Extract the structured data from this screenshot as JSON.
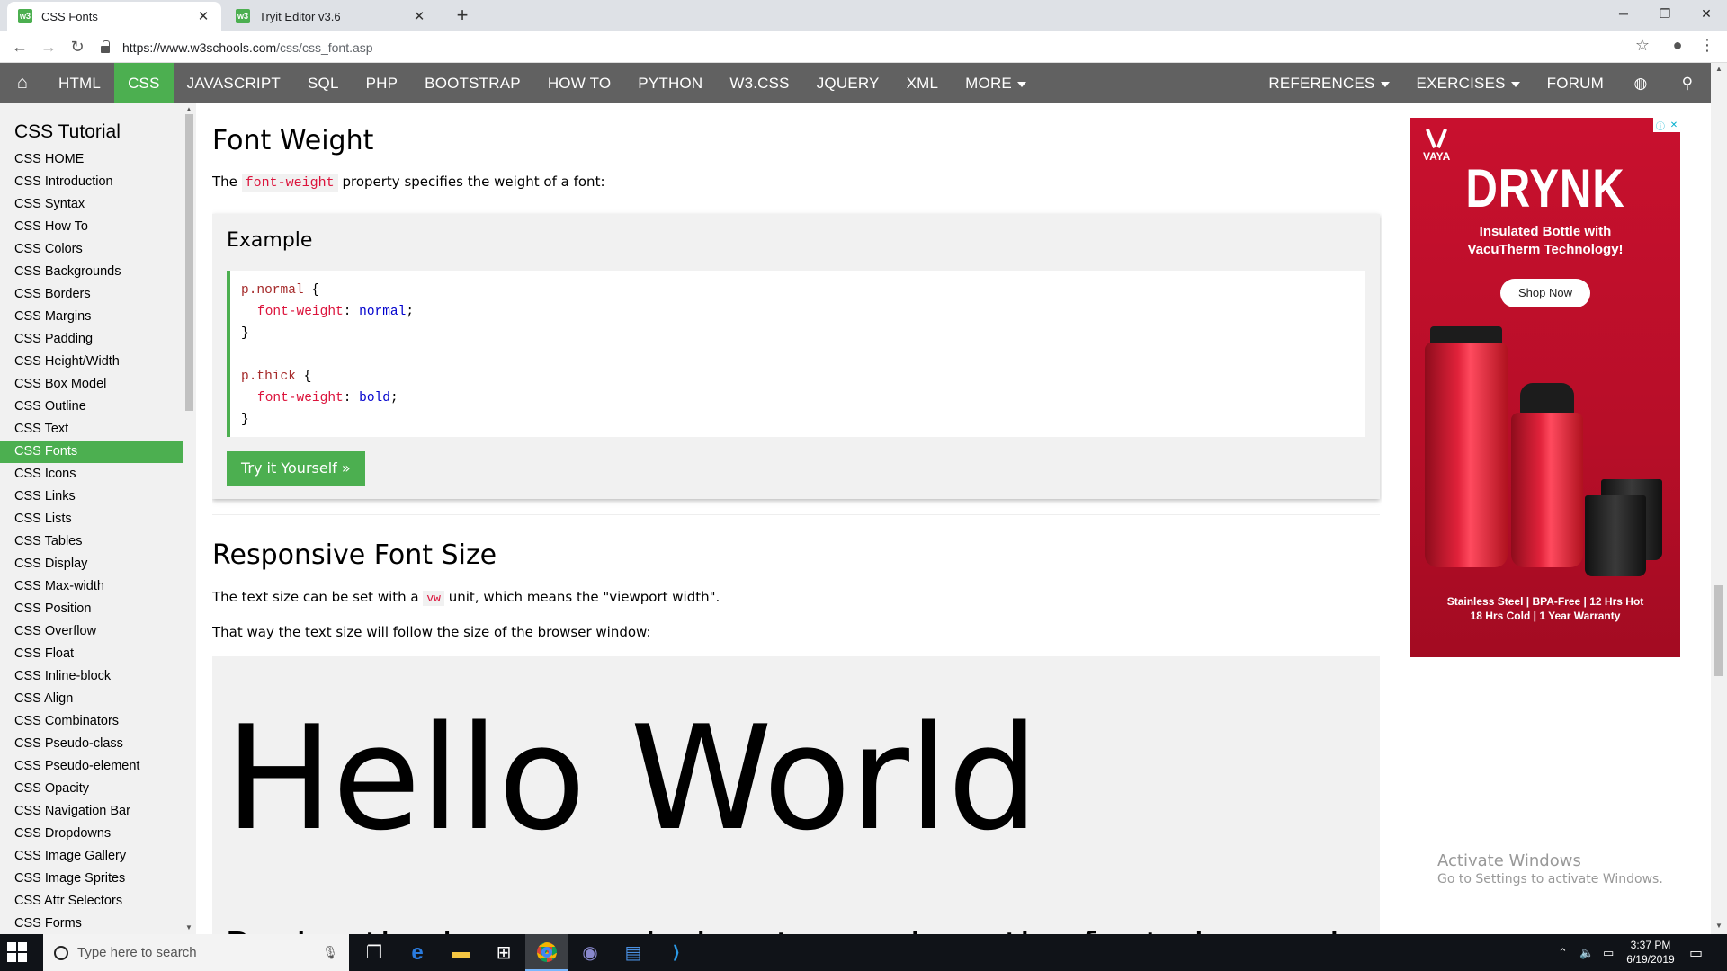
{
  "browser": {
    "tabs": [
      {
        "title": "CSS Fonts",
        "favicon": "w3"
      },
      {
        "title": "Tryit Editor v3.6",
        "favicon": "w3"
      }
    ],
    "new_tab_symbol": "+",
    "window_controls": {
      "minimize": "─",
      "maximize": "❐",
      "close": "✕"
    },
    "url_host": "https://www.w3schools.com",
    "url_path": "/css/css_font.asp"
  },
  "w3nav": {
    "left": [
      "HTML",
      "CSS",
      "JAVASCRIPT",
      "SQL",
      "PHP",
      "BOOTSTRAP",
      "HOW TO",
      "PYTHON",
      "W3.CSS",
      "JQUERY",
      "XML",
      "MORE"
    ],
    "active": "CSS",
    "right": [
      "REFERENCES",
      "EXERCISES",
      "FORUM"
    ]
  },
  "sidebar": {
    "title": "CSS Tutorial",
    "items": [
      "CSS HOME",
      "CSS Introduction",
      "CSS Syntax",
      "CSS How To",
      "CSS Colors",
      "CSS Backgrounds",
      "CSS Borders",
      "CSS Margins",
      "CSS Padding",
      "CSS Height/Width",
      "CSS Box Model",
      "CSS Outline",
      "CSS Text",
      "CSS Fonts",
      "CSS Icons",
      "CSS Links",
      "CSS Lists",
      "CSS Tables",
      "CSS Display",
      "CSS Max-width",
      "CSS Position",
      "CSS Overflow",
      "CSS Float",
      "CSS Inline-block",
      "CSS Align",
      "CSS Combinators",
      "CSS Pseudo-class",
      "CSS Pseudo-element",
      "CSS Opacity",
      "CSS Navigation Bar",
      "CSS Dropdowns",
      "CSS Image Gallery",
      "CSS Image Sprites",
      "CSS Attr Selectors",
      "CSS Forms"
    ],
    "active_item": "CSS Fonts"
  },
  "main": {
    "heading1": "Font Weight",
    "p1_before": "The ",
    "p1_code": "font-weight",
    "p1_after": " property specifies the weight of a font:",
    "example": {
      "title": "Example",
      "selector1": "p.normal",
      "property": "font-weight",
      "value1": "normal",
      "selector2": "p.thick",
      "value2": "bold",
      "open_brace": "{",
      "close_brace": "}",
      "colon": ":",
      "semicolon": ";",
      "button": "Try it Yourself »"
    },
    "heading2": "Responsive Font Size",
    "p2_before": "The text size can be set with a ",
    "p2_code": "vw",
    "p2_after": " unit, which means the \"viewport width\".",
    "p3": "That way the text size will follow the size of the browser window:",
    "demo_big": "Hello World",
    "demo_small": "Resize the browser window to see how the font size scales."
  },
  "ad": {
    "brand": "VAYA",
    "headline": "DRYNK",
    "tagline_1": "Insulated Bottle with",
    "tagline_2": "VacuTherm Technology!",
    "cta": "Shop Now",
    "footer_1": "Stainless Steel  |  BPA-Free  |  12 Hrs Hot",
    "footer_2": "18 Hrs Cold  |  1 Year Warranty",
    "colors": {
      "background": "#c8102e"
    }
  },
  "watermark": {
    "line1": "Activate Windows",
    "line2": "Go to Settings to activate Windows."
  },
  "taskbar": {
    "search_placeholder": "Type here to search",
    "time": "3:37 PM",
    "date": "6/19/2019"
  },
  "colors": {
    "accent": "#4caf50",
    "nav": "#616161",
    "code_red": "#dc143c",
    "code_blue": "#0000cd"
  }
}
